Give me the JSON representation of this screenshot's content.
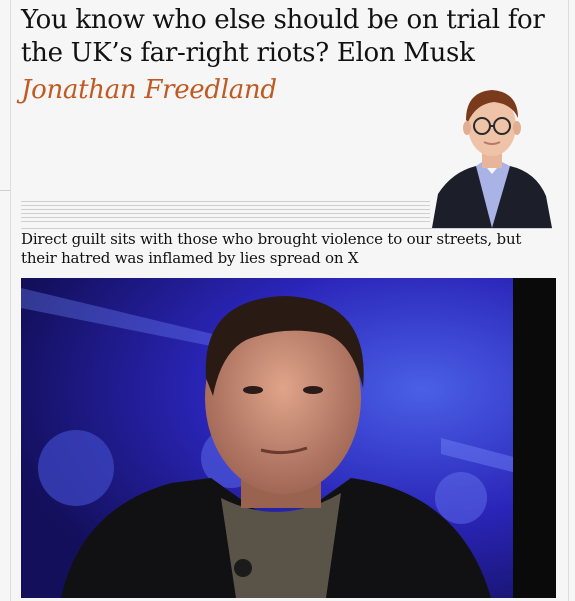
{
  "article": {
    "headline": "You know who else should be on trial for the UK’s far-right riots? Elon Musk",
    "byline": "Jonathan Freedland",
    "standfirst": "Direct guilt sits with those who brought violence to our streets, but their hatred was inflamed by lies spread on X"
  },
  "colors": {
    "byline": "#c05a22",
    "text": "#121212",
    "background": "#f6f6f6",
    "photo_backdrop": "#2a1fa8"
  }
}
